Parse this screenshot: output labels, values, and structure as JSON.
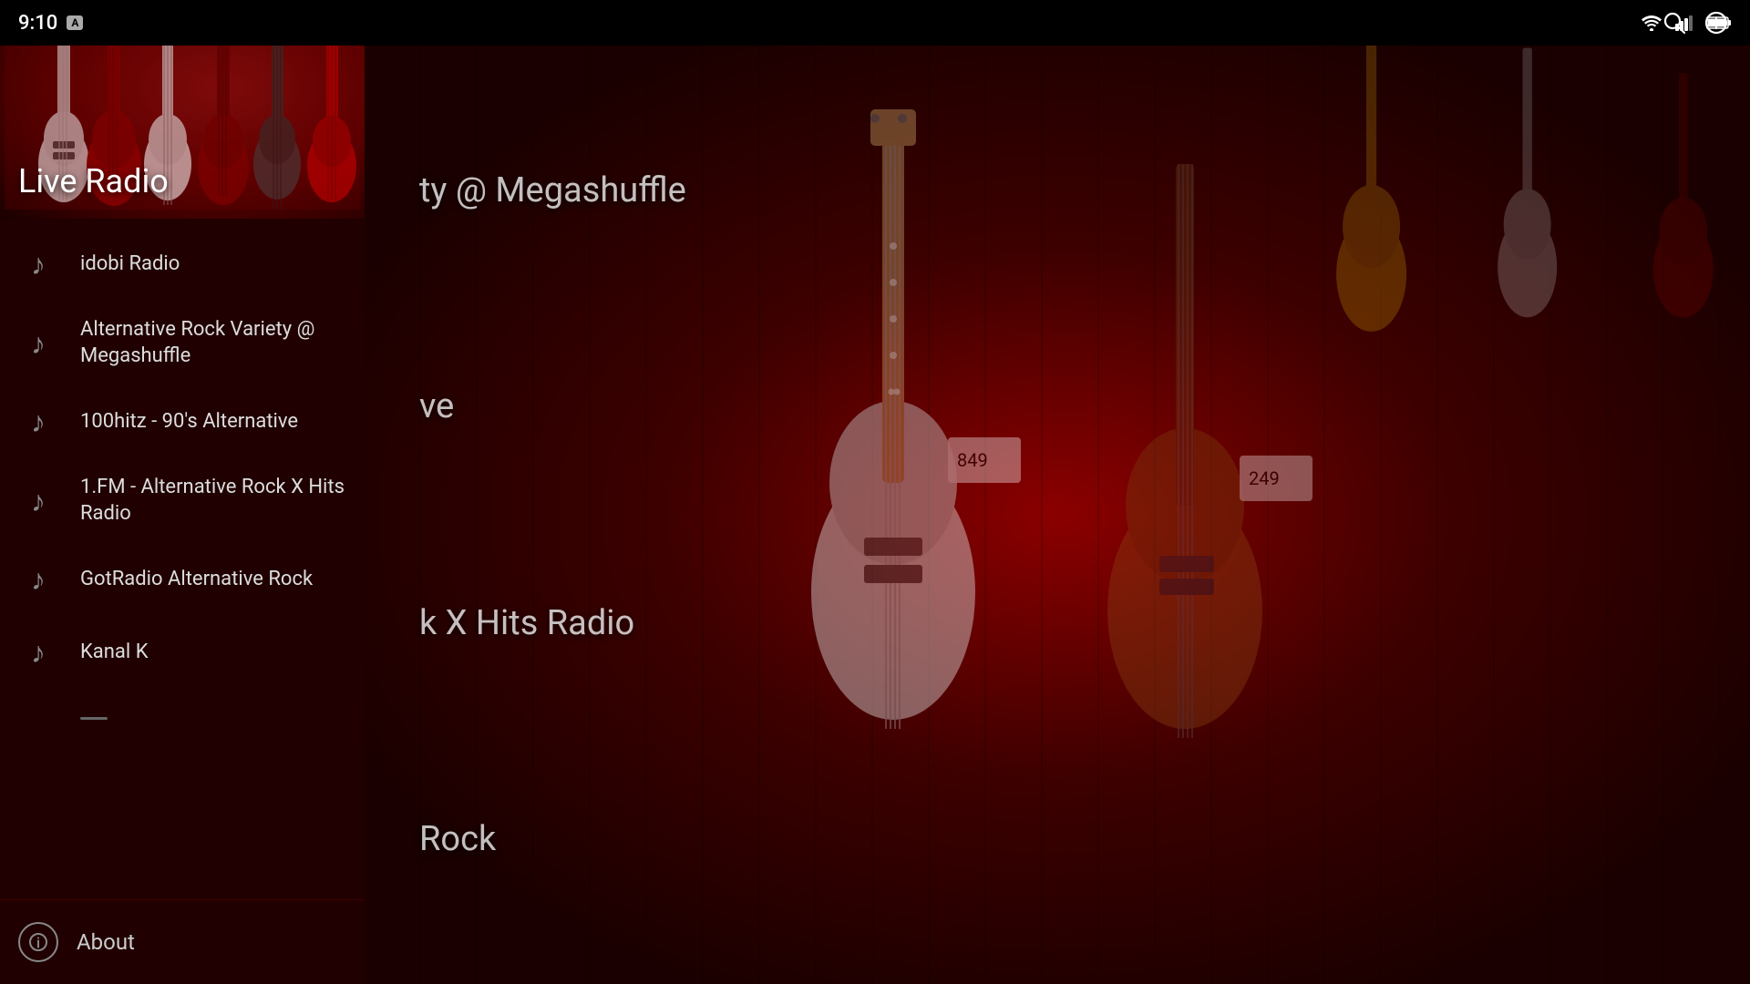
{
  "status_bar": {
    "time": "9:10",
    "badge": "A"
  },
  "header": {
    "title": "Live Radio"
  },
  "toolbar": {
    "search_label": "Search",
    "info_label": "Info"
  },
  "stations": [
    {
      "id": 1,
      "name": "idobi Radio"
    },
    {
      "id": 2,
      "name": "Alternative Rock Variety @ Megashuffle"
    },
    {
      "id": 3,
      "name": "100hitz - 90's Alternative"
    },
    {
      "id": 4,
      "name": "1.FM - Alternative Rock X Hits Radio"
    },
    {
      "id": 5,
      "name": "GotRadio Alternative Rock"
    },
    {
      "id": 6,
      "name": "Kanal K"
    }
  ],
  "main_labels": [
    {
      "text": "ty @ Megashuffle"
    },
    {
      "text": "ve"
    },
    {
      "text": "k X Hits Radio"
    },
    {
      "text": "Rock"
    }
  ],
  "about": {
    "label": "About"
  },
  "colors": {
    "accent": "#8b0000",
    "sidebar_bg": "#200000",
    "header_bg": "#3d0000"
  }
}
